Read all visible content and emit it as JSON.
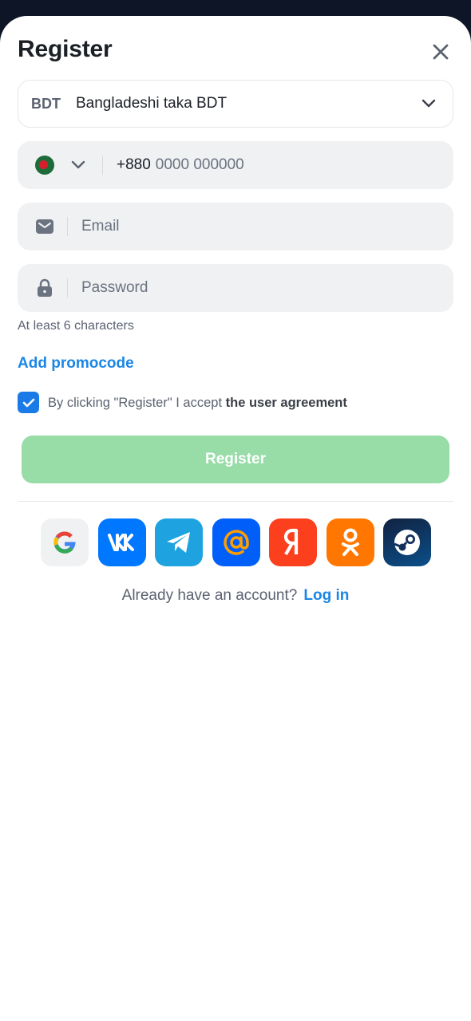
{
  "header": {
    "title": "Register"
  },
  "currency": {
    "code": "BDT",
    "name": "Bangladeshi taka BDT"
  },
  "phone": {
    "code": "+880",
    "placeholder": "0000 000000"
  },
  "email": {
    "placeholder": "Email"
  },
  "password": {
    "placeholder": "Password",
    "hint": "At least 6 characters"
  },
  "promo": {
    "label": "Add promocode"
  },
  "agreement": {
    "checked": true,
    "text": "By clicking \"Register\" I accept",
    "link": "the user agreement"
  },
  "register_button": {
    "label": "Register"
  },
  "socials": [
    "google",
    "vk",
    "telegram",
    "mail-ru",
    "yandex",
    "odnoklassniki",
    "steam"
  ],
  "footer": {
    "text": "Already have an account?",
    "link": "Log in"
  },
  "colors": {
    "accent": "#1a86e6",
    "register_bg": "#98dca8",
    "field_bg": "#eff1f3",
    "checkbox": "#1a7be6"
  }
}
